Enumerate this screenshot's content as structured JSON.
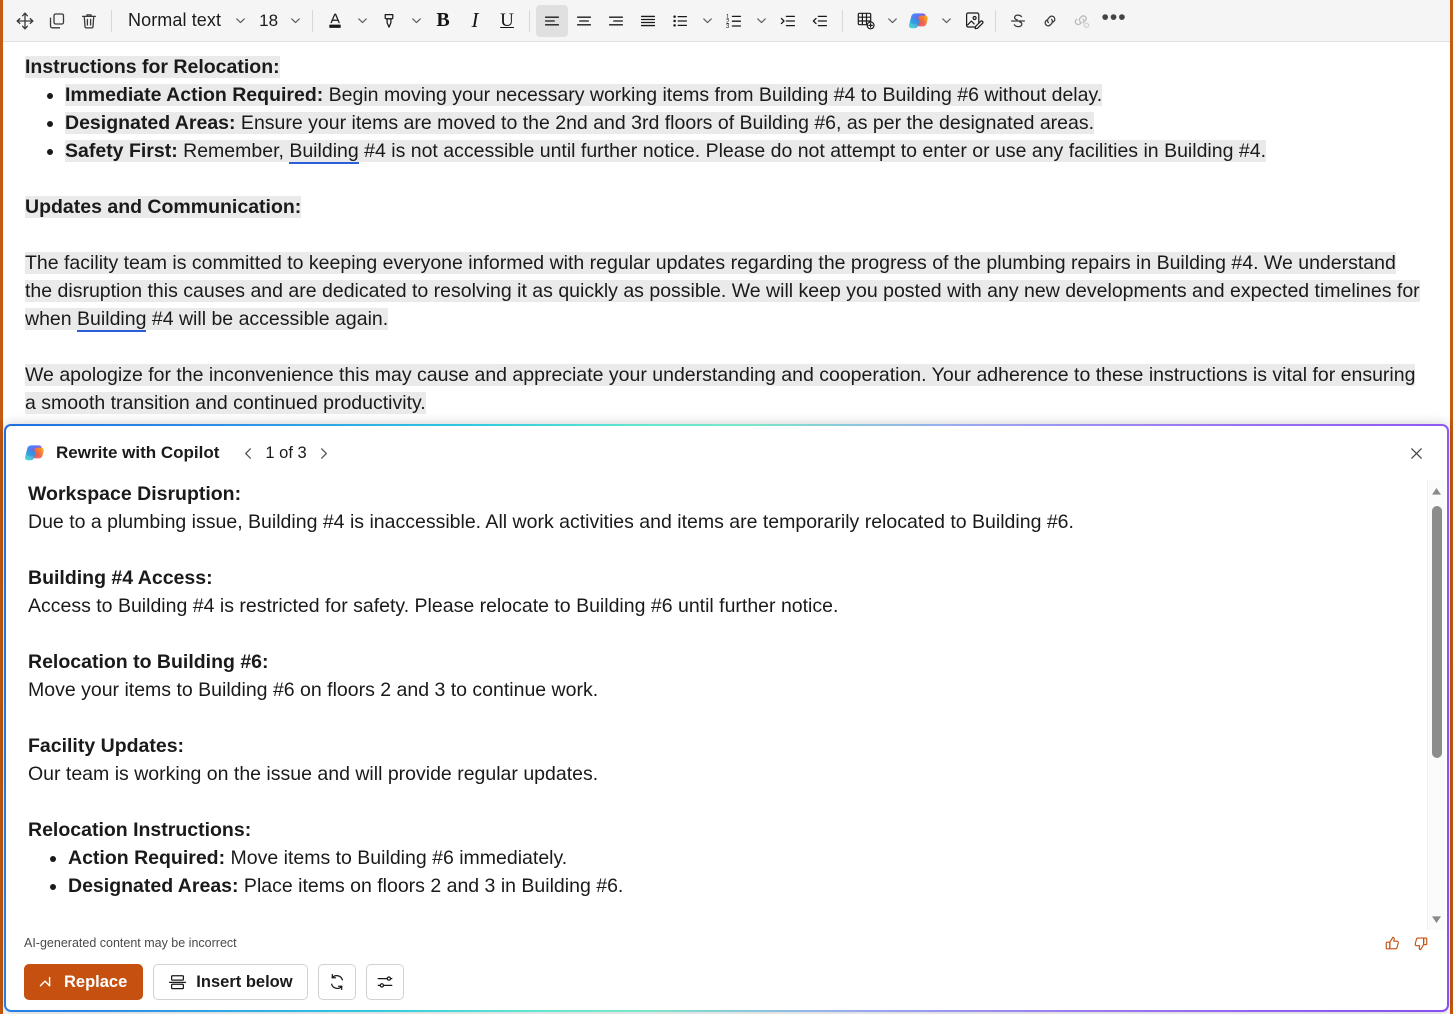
{
  "toolbar": {
    "move_label": "move-object",
    "duplicate_label": "duplicate",
    "delete_label": "delete",
    "paragraph_style": "Normal text",
    "font_size": "18",
    "bold_label": "B",
    "italic_label": "I",
    "underline_label": "U",
    "more_label": "•••",
    "icons": [
      "move-icon",
      "duplicate-icon",
      "delete-icon",
      "font-color-icon",
      "highlight-icon",
      "bold-icon",
      "italic-icon",
      "underline-icon",
      "align-left-icon",
      "align-center-icon",
      "align-right-icon",
      "align-justify-icon",
      "bulleted-list-icon",
      "numbered-list-icon",
      "increase-indent-icon",
      "decrease-indent-icon",
      "insert-table-icon",
      "copilot-icon",
      "image-edit-icon",
      "strikethrough-icon",
      "insert-link-icon",
      "remove-link-icon",
      "more-options-icon"
    ]
  },
  "document": {
    "section1_heading": "Instructions for Relocation:",
    "bullets": [
      {
        "bold": "Immediate Action Required:",
        "text": " Begin moving your necessary working items from Building #4 to Building #6 without delay."
      },
      {
        "bold": "Designated Areas:",
        "text": " Ensure your items are moved to the 2nd and 3rd floors of Building #6, as per the designated areas."
      },
      {
        "bold": "Safety First:",
        "text_before": " Remember, ",
        "grammar_word": "Building",
        "text_after": " #4 is not accessible until further notice. Please do not attempt to enter or use any facilities in Building #4."
      }
    ],
    "section2_heading": "Updates and Communication:",
    "paragraph1_before": "The facility team is committed to keeping everyone informed with regular updates regarding the progress of the plumbing repairs in Building #4. We understand the disruption this causes and are dedicated to resolving it as quickly as possible. We will keep you posted with any new developments and expected timelines for when ",
    "paragraph1_grammar": "Building",
    "paragraph1_after": " #4 will be accessible again.",
    "paragraph2": "We apologize for the inconvenience this may cause and appreciate your understanding and cooperation. Your adherence to these instructions is vital for ensuring a smooth transition and continued productivity."
  },
  "copilot_panel": {
    "title": "Rewrite with Copilot",
    "logo_icon": "copilot-logo-icon",
    "prev_icon": "chevron-left-icon",
    "next_icon": "chevron-right-icon",
    "pager": "1 of 3",
    "close_icon": "close-icon",
    "blocks": [
      {
        "heading": "Workspace Disruption:",
        "body": "Due to a plumbing issue, Building #4 is inaccessible. All work activities and items are temporarily relocated to Building #6."
      },
      {
        "heading": "Building #4 Access:",
        "body": "Access to Building #4 is restricted for safety. Please relocate to Building #6 until further notice."
      },
      {
        "heading": "Relocation to Building #6:",
        "body": "Move your items to Building #6 on floors 2 and 3 to continue work."
      },
      {
        "heading": "Facility Updates:",
        "body": "Our team is working on the issue and will provide regular updates."
      }
    ],
    "last_block_heading": "Relocation Instructions:",
    "last_block_bullets": [
      {
        "bold": "Action Required:",
        "text": " Move items to Building #6 immediately."
      },
      {
        "bold": "Designated Areas:",
        "text": " Place items on floors 2 and 3 in Building #6."
      }
    ],
    "disclaimer": "AI-generated content may be incorrect",
    "thumbs_up_icon": "thumbs-up-icon",
    "thumbs_down_icon": "thumbs-down-icon",
    "replace_label": "Replace",
    "replace_icon": "replace-arrow-icon",
    "insert_below_label": "Insert below",
    "insert_below_icon": "insert-below-icon",
    "regenerate_icon": "regenerate-icon",
    "settings_icon": "adjust-settings-icon",
    "scrollbar_up_icon": "scroll-up-arrow-icon",
    "scrollbar_down_icon": "scroll-down-arrow-icon"
  },
  "colors": {
    "accent_orange": "#c5500f",
    "doc_frame": "#c55a11",
    "selection": "#eaeaea",
    "grammar_underline": "#2b5fd9"
  }
}
